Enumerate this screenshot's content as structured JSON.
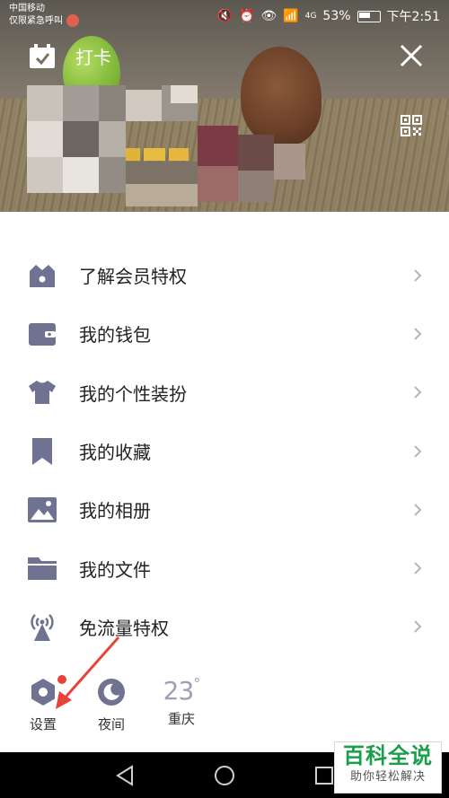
{
  "status_bar": {
    "carrier_line1": "中国移动",
    "carrier_line2": "仅限紧急呼叫",
    "signal": "4G",
    "battery_percent": "53%",
    "time": "下午2:51"
  },
  "header": {
    "checkin_label": "打卡",
    "checkin_icon": "calendar-check-icon",
    "close_icon": "close-icon",
    "qr_icon": "qr-code-icon"
  },
  "menu": {
    "items": [
      {
        "label": "了解会员特权",
        "icon": "crown-basket-icon"
      },
      {
        "label": "我的钱包",
        "icon": "wallet-icon"
      },
      {
        "label": "我的个性装扮",
        "icon": "tshirt-icon"
      },
      {
        "label": "我的收藏",
        "icon": "bookmark-icon"
      },
      {
        "label": "我的相册",
        "icon": "photo-icon"
      },
      {
        "label": "我的文件",
        "icon": "folder-icon"
      },
      {
        "label": "免流量特权",
        "icon": "antenna-icon"
      }
    ]
  },
  "bottom": {
    "settings_label": "设置",
    "night_label": "夜间",
    "temperature": "23",
    "temperature_unit": "°",
    "city": "重庆"
  },
  "watermark": {
    "title": "百科全说",
    "subtitle": "助你轻松解决"
  },
  "colors": {
    "icon_gray": "#6f7391",
    "accent_red": "#e8433a"
  }
}
